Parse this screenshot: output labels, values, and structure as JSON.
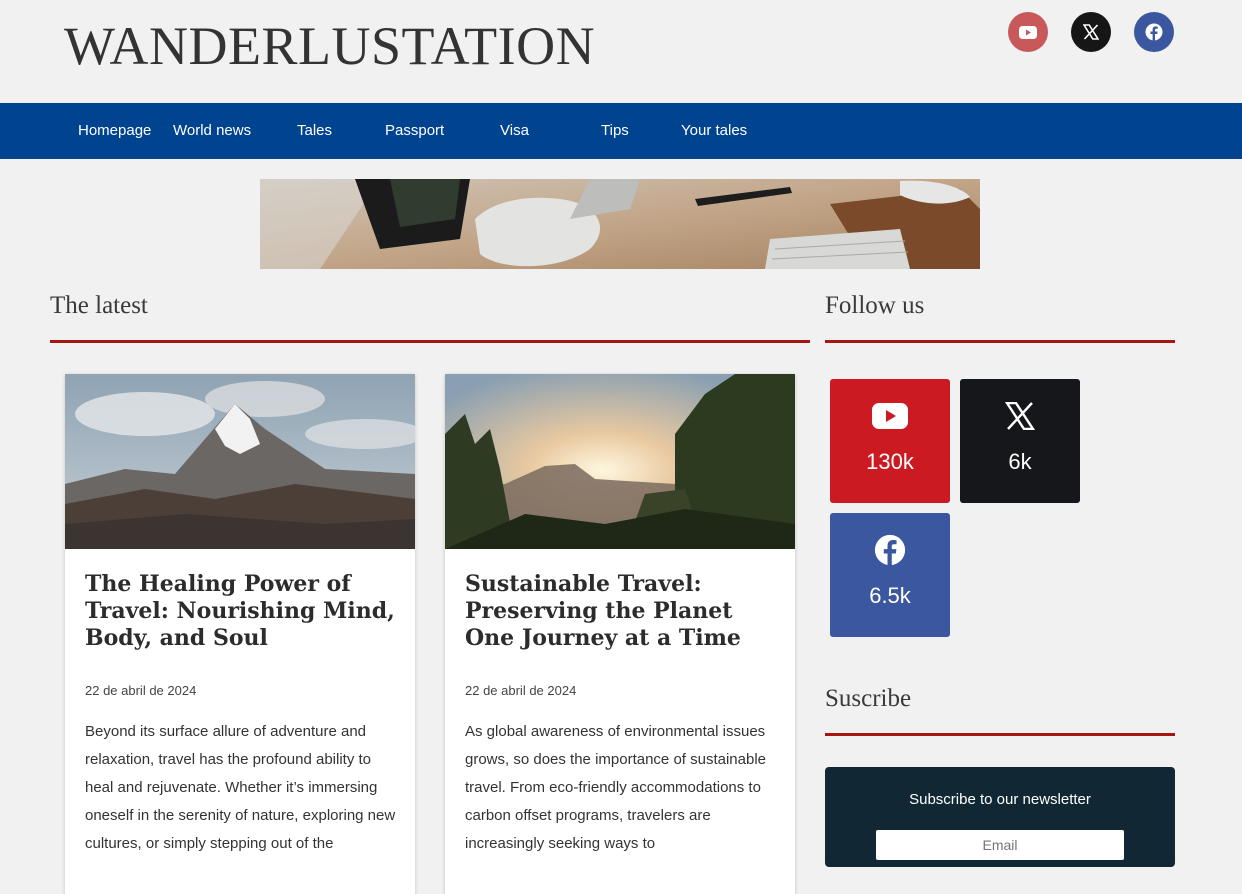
{
  "site": {
    "title": "WANDERLUSTATION"
  },
  "header_social": [
    {
      "network": "youtube",
      "icon": "youtube-icon",
      "color": "#c9585a"
    },
    {
      "network": "x",
      "icon": "x-icon",
      "color": "#161616"
    },
    {
      "network": "facebook",
      "icon": "facebook-icon",
      "color": "#3b57a0"
    }
  ],
  "nav": {
    "items": [
      "Homepage",
      "World news",
      "Tales",
      "Passport",
      "Visa",
      "Tips",
      "Your tales"
    ],
    "background": "#00438f"
  },
  "main": {
    "latest_title": "The latest",
    "accent_color": "#a81613",
    "posts": [
      {
        "title": "The Healing Power of Travel: Nourishing Mind, Body, and Soul",
        "date": "22 de abril de 2024",
        "excerpt": "Beyond its surface allure of adventure and relaxation, travel has the profound ability to heal and rejuvenate. Whether it’s immersing oneself in the serenity of nature, exploring new cultures, or simply stepping out of the"
      },
      {
        "title": "Sustainable Travel: Preserving the Planet One Journey at a Time",
        "date": "22 de abril de 2024",
        "excerpt": "As global awareness of environmental issues grows, so does the importance of sustainable travel. From eco-friendly accommodations to carbon offset programs, travelers are increasingly seeking ways to"
      }
    ]
  },
  "sidebar": {
    "follow_title": "Follow us",
    "follow_tiles": [
      {
        "network": "youtube",
        "icon": "youtube-icon",
        "count": "130k",
        "color": "#cc1a22"
      },
      {
        "network": "x",
        "icon": "x-icon",
        "count": "6k",
        "color": "#15171a"
      },
      {
        "network": "facebook",
        "icon": "facebook-icon",
        "count": "6.5k",
        "color": "#3b57a0"
      }
    ],
    "subscribe_title": "Suscribe",
    "newsletter": {
      "label": "Subscribe to our newsletter",
      "placeholder": "Email"
    }
  }
}
